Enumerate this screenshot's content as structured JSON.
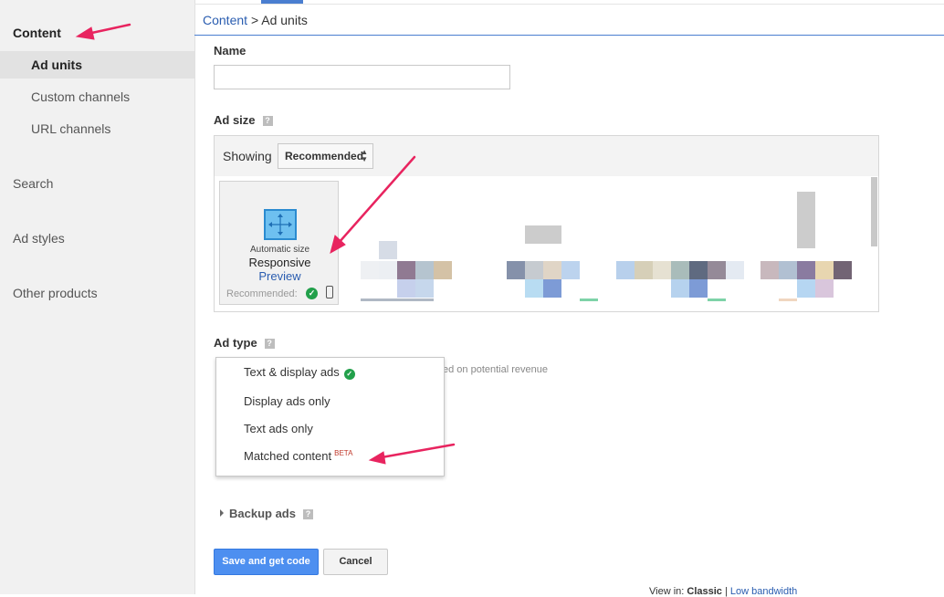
{
  "sidebar": {
    "content": "Content",
    "ad_units": "Ad units",
    "custom_channels": "Custom channels",
    "url_channels": "URL channels",
    "search": "Search",
    "ad_styles": "Ad styles",
    "other_products": "Other products"
  },
  "breadcrumb": {
    "root": "Content",
    "separator": ">",
    "current": "Ad units"
  },
  "form": {
    "name_label": "Name",
    "name_value": "",
    "ad_size_label": "Ad size",
    "showing_label": "Showing",
    "showing_value": "Recommended",
    "responsive": {
      "subtitle": "Automatic size",
      "title": "Responsive",
      "preview": "Preview",
      "recommended": "Recommended:"
    },
    "ad_type_label": "Ad type",
    "ad_type_hint": "ed on potential revenue",
    "ad_type_options": [
      "Text & display ads",
      "Display ads only",
      "Text ads only",
      "Matched content"
    ],
    "beta_badge": "BETA",
    "backup_ads": "Backup ads",
    "help_glyph": "?",
    "save_button": "Save and get code",
    "cancel_button": "Cancel"
  },
  "footer": {
    "view_in": "View in:",
    "classic": "Classic",
    "separator": "|",
    "low_bandwidth": "Low bandwidth"
  },
  "colors": {
    "accent_blue": "#4a7ed0",
    "primary_button": "#4d8ff0",
    "success_green": "#22a04b",
    "annotation_arrow": "#e8245f",
    "beta_red": "#c0392b"
  }
}
